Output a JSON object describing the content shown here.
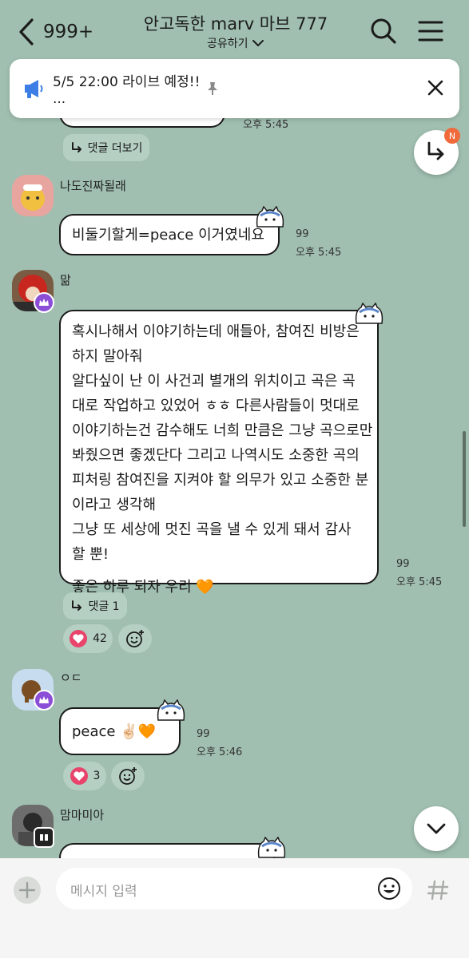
{
  "header": {
    "back_count": "999+",
    "title": "안고독한 marv 마브 777",
    "subtitle": "공유하기"
  },
  "notice": {
    "title": "5/5 22:00 라이브 예정!!",
    "subtitle": "..."
  },
  "top_remnant": {
    "time": "오후 5:45",
    "reply_label": "댓글 더보기"
  },
  "messages": [
    {
      "sender": "나도진짜될래",
      "text": "비둘기할게=peace 이거였네요",
      "count": "99",
      "time": "오후 5:45"
    },
    {
      "sender": "맒",
      "lines": [
        "혹시나해서 이야기하는데 애들아, 참여진 비방은",
        "하지 말아줘",
        "알다싶이 난 이 사건괴 별개의 위치이고 곡은 곡",
        "대로 작업하고 있었어 ㅎㅎ 다른사람들이 멋대로",
        "이야기하는건 감수해도 너희 만큼은 그냥 곡으로만",
        "봐줬으면 좋겠단다 그리고 나역시도 소중한 곡의",
        "피처링 참여진을 지켜야 할 의무가 있고 소중한 분",
        "이라고 생각해",
        "그냥 또 세상에 멋진 곡을 낼 수 있게 돼서 감사",
        "할 뿐!",
        "좋은 하루 되자 우리 🧡"
      ],
      "count": "99",
      "time": "오후 5:45",
      "reply_label": "댓글 1",
      "likes": "42"
    },
    {
      "sender": "ㅇㄷ",
      "text": "peace ✌🏻🧡",
      "count": "99",
      "time": "오후 5:46",
      "likes": "3"
    },
    {
      "sender": "맘마미아"
    }
  ],
  "float_badge": "N",
  "input": {
    "placeholder": "메시지 입력"
  },
  "colors": {
    "background": "#a0bfb0",
    "bubble": "#ffffff",
    "heart": "#e8446c",
    "crown": "#8b4ed6",
    "badge": "#f06a3b"
  }
}
